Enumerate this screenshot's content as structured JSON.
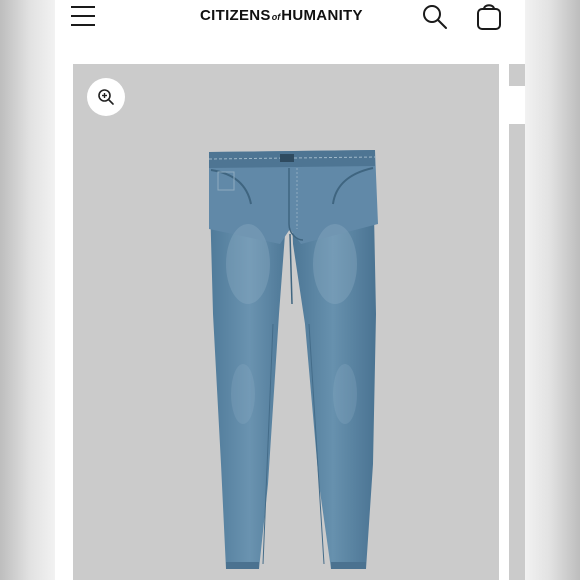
{
  "header": {
    "brand_left": "CITIZENS",
    "brand_of": "of",
    "brand_right": "HUMANITY",
    "menu_icon": "hamburger-menu-icon",
    "search_icon": "search-icon",
    "bag_icon": "shopping-bag-icon"
  },
  "product_gallery": {
    "zoom_icon": "zoom-in-icon",
    "image_subject": "blue denim jeans",
    "background_color": "#cbcbcb",
    "denim_color": "#5b85a4"
  }
}
